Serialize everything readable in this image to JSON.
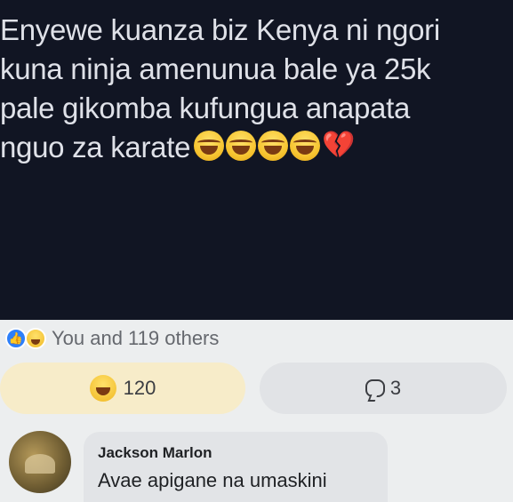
{
  "post": {
    "text": "Enyewe kuanza biz Kenya ni ngori\nkuna ninja amenunua bale ya 25k\npale gikomba kufungua anapata\nnguo za karate",
    "emojis": [
      "laughing-tears-icon",
      "laughing-tears-icon",
      "laughing-tears-icon",
      "laughing-tears-icon",
      "broken-heart-icon"
    ],
    "background_color": "#111523"
  },
  "reactions": {
    "summary_text": "You and 119 others",
    "haha_count": "120",
    "comment_count": "3"
  },
  "comment": {
    "author": "Jackson Marlon",
    "text": "Avae apigane na umaskini"
  },
  "colors": {
    "like_blue": "#2d7ff9",
    "haha_yellow": "#f7c531",
    "reacted_pill": "#f7ecc9",
    "pill_gray": "#e1e3e6"
  }
}
